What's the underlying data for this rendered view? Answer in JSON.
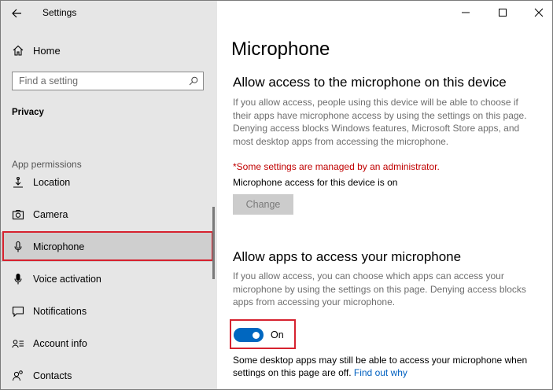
{
  "window": {
    "app_title": "Settings"
  },
  "sidebar": {
    "home_label": "Home",
    "search_placeholder": "Find a setting",
    "section_title": "Privacy",
    "group_label": "App permissions",
    "items": [
      {
        "label": "Location",
        "icon": "location-icon"
      },
      {
        "label": "Camera",
        "icon": "camera-icon"
      },
      {
        "label": "Microphone",
        "icon": "microphone-icon",
        "selected": true
      },
      {
        "label": "Voice activation",
        "icon": "voice-activation-icon"
      },
      {
        "label": "Notifications",
        "icon": "notifications-icon"
      },
      {
        "label": "Account info",
        "icon": "account-info-icon"
      },
      {
        "label": "Contacts",
        "icon": "contacts-icon"
      }
    ]
  },
  "main": {
    "page_title": "Microphone",
    "device_section": {
      "heading": "Allow access to the microphone on this device",
      "description": "If you allow access, people using this device will be able to choose if their apps have microphone access by using the settings on this page. Denying access blocks Windows features, Microsoft Store apps, and most desktop apps from accessing the microphone.",
      "admin_note": "*Some settings are managed by an administrator.",
      "status_text": "Microphone access for this device is on",
      "change_button": "Change"
    },
    "apps_section": {
      "heading": "Allow apps to access your microphone",
      "description": "If you allow access, you can choose which apps can access your microphone by using the settings on this page. Denying access blocks apps from accessing your microphone.",
      "toggle_state": "On",
      "toggle_on": true,
      "footer_note": "Some desktop apps may still be able to access your microphone when settings on this page are off.",
      "footer_link": "Find out why"
    }
  },
  "colors": {
    "accent": "#0067c0",
    "highlight_border": "#d6222f",
    "admin_text": "#c00000",
    "sidebar_bg": "#e6e6e6"
  }
}
